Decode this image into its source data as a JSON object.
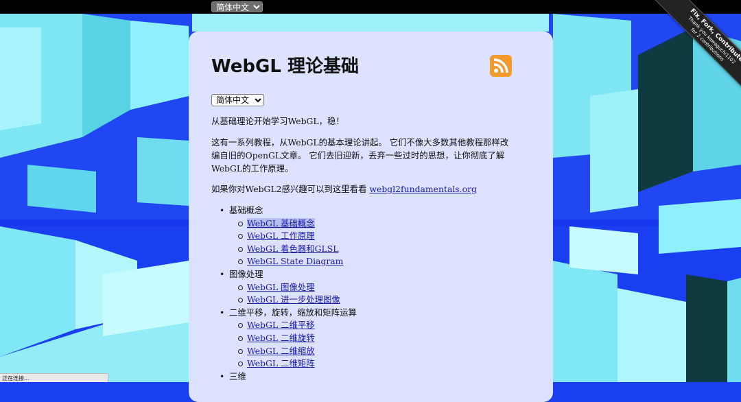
{
  "top_language_select": {
    "selected": "简体中文"
  },
  "ribbon": {
    "line1": "Fix, Fork, Contribute",
    "line2": "Thank you kawaguchi1102",
    "line3": "for 2 contributions"
  },
  "page": {
    "title": "WebGL 理论基础",
    "language_select": {
      "selected": "简体中文"
    },
    "intro": "从基础理论开始学习WebGL，稳！",
    "description": "这有一系列教程，从WebGL的基本理论讲起。 它们不像大多数其他教程那样改编自旧的OpenGL文章。 它们去旧迎新，丢弃一些过时的思想，让你彻底了解WebGL的工作原理。",
    "webgl2_prefix": "如果你对WebGL2感兴趣可以到这里看看 ",
    "webgl2_link": "webgl2fundamentals.org"
  },
  "toc": {
    "sections": [
      {
        "title": "基础概念",
        "links": [
          "WebGL 基础概念",
          "WebGL 工作原理",
          "WebGL 着色器和GLSL",
          "WebGL State Diagram"
        ]
      },
      {
        "title": "图像处理",
        "links": [
          "WebGL 图像处理",
          "WebGL 进一步处理图像"
        ]
      },
      {
        "title": "二维平移，旋转，缩放和矩阵运算",
        "links": [
          "WebGL 二维平移",
          "WebGL 二维旋转",
          "WebGL 二维缩放",
          "WebGL 二维矩阵"
        ]
      },
      {
        "title": "三维",
        "links": []
      }
    ]
  },
  "status_bar": {
    "text": "正在连接..."
  },
  "colors": {
    "rss": "#f29a2e",
    "link": "#1a1aa6",
    "highlight": "#b7bff0"
  }
}
